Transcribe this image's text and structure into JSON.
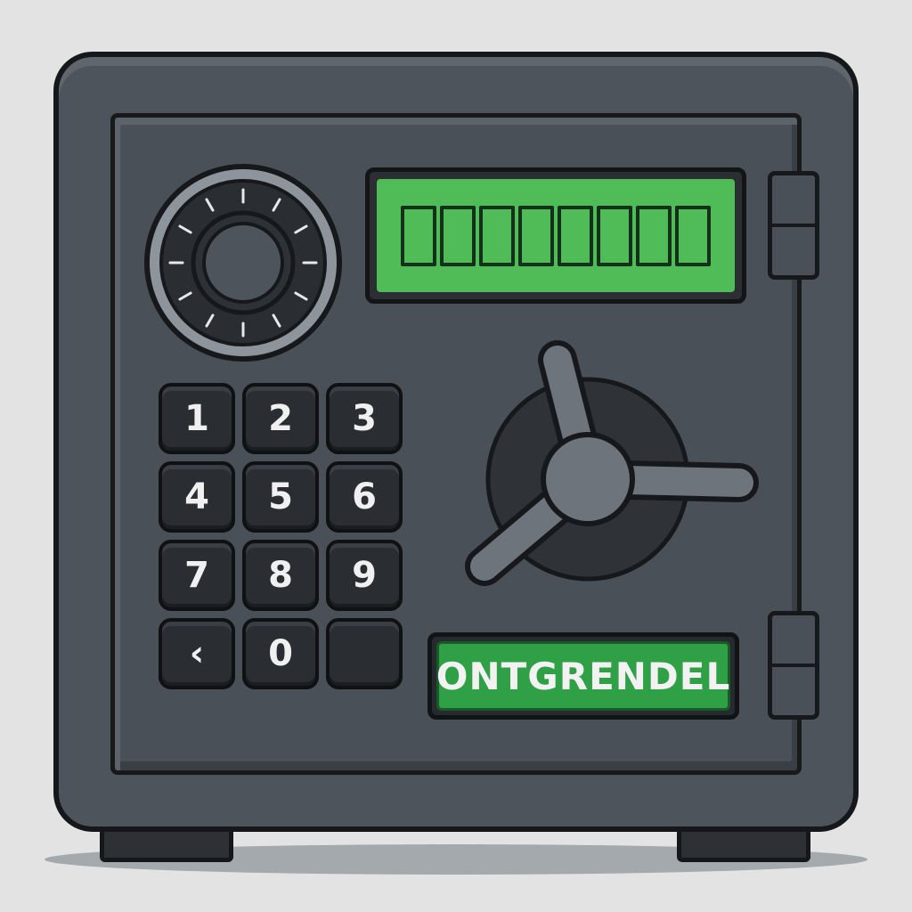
{
  "display": {
    "slots": [
      "",
      "",
      "",
      "",
      "",
      "",
      "",
      ""
    ],
    "screen_color": "#4fbc58"
  },
  "keypad": {
    "keys": [
      "1",
      "2",
      "3",
      "4",
      "5",
      "6",
      "7",
      "8",
      "9",
      "‹",
      "0",
      ""
    ]
  },
  "unlock_button": {
    "label": "ONTGRENDEL",
    "color": "#2fa046"
  },
  "dial": {
    "tick_count": 12
  },
  "colors": {
    "safe_body": "#4e545b",
    "outline": "#15171a",
    "background": "#e3e3e3"
  }
}
